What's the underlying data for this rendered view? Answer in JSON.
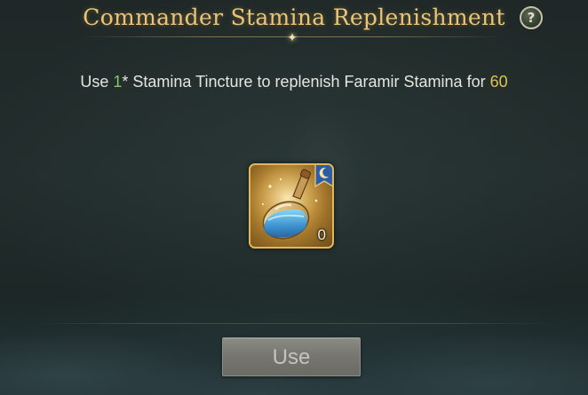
{
  "dialog": {
    "title": "Commander Stamina Replenishment",
    "help_label": "?",
    "description": {
      "part1": "Use ",
      "quantity": "1",
      "part2": "* Stamina Tincture to replenish Faramir Stamina for ",
      "amount": "60"
    },
    "item": {
      "icon": "stamina-tincture-potion",
      "badge_icon": "moon-ribbon-badge",
      "count": "0"
    },
    "use_button_label": "Use"
  },
  "colors": {
    "title": "#e8c57a",
    "quantity": "#86c46b",
    "amount": "#e1c24e",
    "item_border": "#e2b659",
    "button_disabled": "#7a7a74"
  }
}
